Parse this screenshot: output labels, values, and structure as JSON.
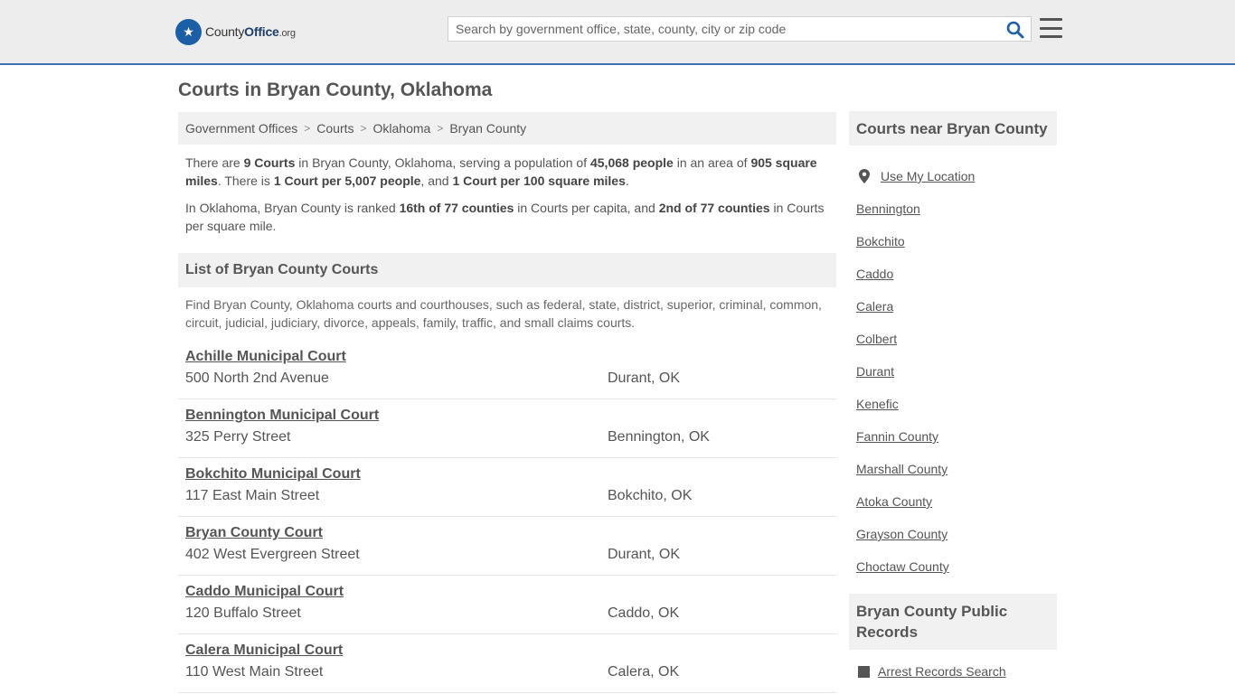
{
  "header": {
    "logo_county": "County",
    "logo_office": "Office",
    "logo_tld": ".org",
    "search_placeholder": "Search by government office, state, county, city or zip code"
  },
  "page_title": "Courts in Bryan County, Oklahoma",
  "breadcrumb": [
    "Government Offices",
    "Courts",
    "Oklahoma",
    "Bryan County"
  ],
  "intro": {
    "p1": {
      "a": "There are ",
      "b1": "9 Courts",
      "c": " in Bryan County, Oklahoma, serving a population of ",
      "b2": "45,068 people",
      "d": " in an area of ",
      "b3": "905 square miles",
      "e": ". There is ",
      "b4": "1 Court per 5,007 people",
      "f": ", and ",
      "b5": "1 Court per 100 square miles",
      "g": "."
    },
    "p2": {
      "a": "In Oklahoma, Bryan County is ranked ",
      "b1": "16th of 77 counties",
      "c": " in Courts per capita, and ",
      "b2": "2nd of 77 counties",
      "d": " in Courts per square mile."
    }
  },
  "list_section": {
    "title": "List of Bryan County Courts",
    "description": "Find Bryan County, Oklahoma courts and courthouses, such as federal, state, district, superior, criminal, common, circuit, judicial, judiciary, divorce, appeals, family, traffic, and small claims courts."
  },
  "courts": [
    {
      "name": "Achille Municipal Court",
      "address": "500 North 2nd Avenue",
      "city": "Durant, OK"
    },
    {
      "name": "Bennington Municipal Court",
      "address": "325 Perry Street",
      "city": "Bennington, OK"
    },
    {
      "name": "Bokchito Municipal Court",
      "address": "117 East Main Street",
      "city": "Bokchito, OK"
    },
    {
      "name": "Bryan County Court",
      "address": "402 West Evergreen Street",
      "city": "Durant, OK"
    },
    {
      "name": "Caddo Municipal Court",
      "address": "120 Buffalo Street",
      "city": "Caddo, OK"
    },
    {
      "name": "Calera Municipal Court",
      "address": "110 West Main Street",
      "city": "Calera, OK"
    }
  ],
  "sidebar": {
    "nearby_title": "Courts near Bryan County",
    "use_location": "Use My Location",
    "nearby": [
      "Bennington",
      "Bokchito",
      "Caddo",
      "Calera",
      "Colbert",
      "Durant",
      "Kenefic",
      "Fannin County",
      "Marshall County",
      "Atoka County",
      "Grayson County",
      "Choctaw County"
    ],
    "records_title": "Bryan County Public Records",
    "records": [
      "Arrest Records Search"
    ]
  },
  "colors": {
    "accent": "#3b73b3",
    "logo_blue": "#1d5fa6",
    "search_icon": "#1f5fa8"
  }
}
